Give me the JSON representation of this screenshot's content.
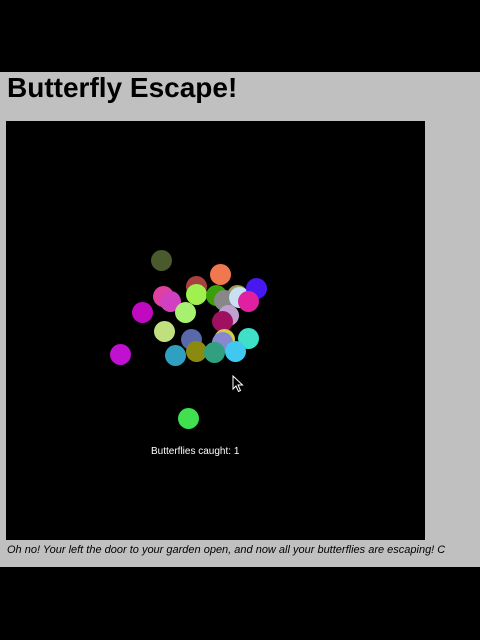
{
  "title": "Butterfly Escape!",
  "score_text": "Butterflies caught: 1",
  "description": "Oh no! Your left the door to your garden open, and now all your butterflies are escaping! C",
  "colors": {
    "outer_background": "#000000",
    "page_background": "#c0c0c0",
    "canvas_background": "#000000",
    "text": "#000000",
    "score_text": "#ffffff"
  },
  "butterflies": [
    {
      "color": "#4b5a2c"
    },
    {
      "color": "#f07850"
    },
    {
      "color": "#a84040"
    },
    {
      "color": "#e040a0"
    },
    {
      "color": "#c00ac0"
    },
    {
      "color": "#d040c0"
    },
    {
      "color": "#a8f070"
    },
    {
      "color": "#a0f050"
    },
    {
      "color": "#3aa00a"
    },
    {
      "color": "#a0a060"
    },
    {
      "color": "#888888"
    },
    {
      "color": "#c8e0f0"
    },
    {
      "color": "#4818f0"
    },
    {
      "color": "#e020a0"
    },
    {
      "color": "#c0a0d0"
    },
    {
      "color": "#a01060"
    },
    {
      "color": "#c0e080"
    },
    {
      "color": "#5868a8"
    },
    {
      "color": "#d0d040"
    },
    {
      "color": "#8888d0"
    },
    {
      "color": "#40e0c8"
    },
    {
      "color": "#c010d0"
    },
    {
      "color": "#30a0c0"
    },
    {
      "color": "#8a8a10"
    },
    {
      "color": "#30a080"
    },
    {
      "color": "#40c8f0"
    },
    {
      "color": "#40e050"
    }
  ]
}
